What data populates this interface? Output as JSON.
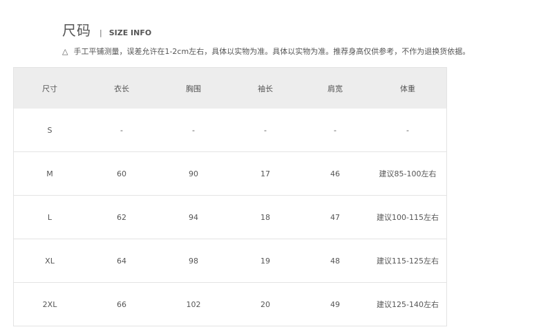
{
  "header": {
    "title_cn": "尺码",
    "separator": "|",
    "title_en": "SIZE INFO"
  },
  "note": {
    "icon": "△",
    "text": "手工平铺测量，误差允许在1-2cm左右，具体以实物为准。具体以实物为准。推荐身高仅供参考，不作为退换货依据。"
  },
  "table": {
    "headers": [
      "尺寸",
      "衣长",
      "胸围",
      "袖长",
      "肩宽",
      "体重"
    ],
    "rows": [
      [
        "S",
        "-",
        "-",
        "-",
        "-",
        "-"
      ],
      [
        "M",
        "60",
        "90",
        "17",
        "46",
        "建议85-100左右"
      ],
      [
        "L",
        "62",
        "94",
        "18",
        "47",
        "建议100-115左右"
      ],
      [
        "XL",
        "64",
        "98",
        "19",
        "48",
        "建议115-125左右"
      ],
      [
        "2XL",
        "66",
        "102",
        "20",
        "49",
        "建议125-140左右"
      ]
    ]
  }
}
